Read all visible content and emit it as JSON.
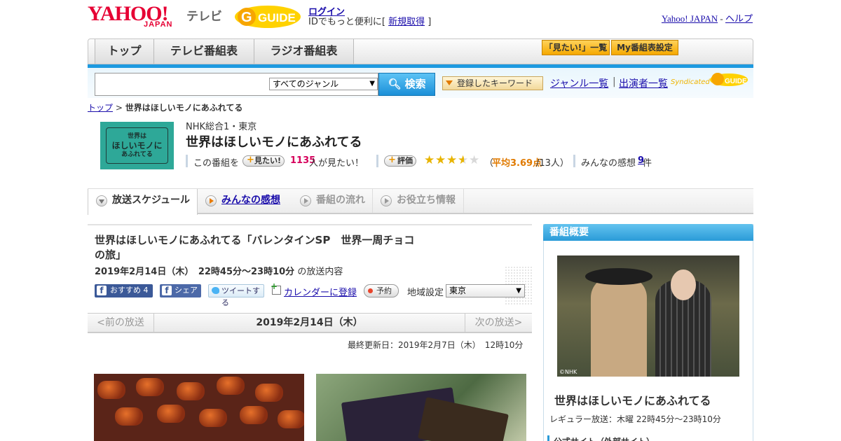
{
  "header": {
    "logo": "YAHOO!",
    "logo_sub": "JAPAN",
    "tv_label": "テレビ",
    "guide_logo": "GUIDE",
    "login": "ログイン",
    "login_prompt": "IDでもっと便利に[",
    "signup": "新規取得",
    "login_close": "]",
    "yahoo_japan": "Yahoo! JAPAN",
    "dash": "-",
    "help": "ヘルプ"
  },
  "nav": {
    "tabs": [
      "トップ",
      "テレビ番組表",
      "ラジオ番組表"
    ],
    "watchlist": "「見たい!」一覧",
    "my_settings": "My番組表設定"
  },
  "search": {
    "genre": "すべてのジャンル",
    "button": "検索",
    "keywords": "登録したキーワード",
    "genre_list": "ジャンル一覧",
    "sep": "|",
    "cast_list": "出演者一覧",
    "syndicated": "Syndicated"
  },
  "breadcrumb": {
    "home": "トップ",
    "sep": ">",
    "current": "世界はほしいモノにあふれてる"
  },
  "program": {
    "thumb_text_1": "世界は",
    "thumb_text_2": "ほしいモノに",
    "thumb_text_3": "あふれてる",
    "station": "NHK総合1・東京",
    "title": "世界はほしいモノにあふれてる",
    "this_program": "この番組を",
    "mitai": "見たい!",
    "mitai_count": "1135",
    "mitai_suffix": "人が見たい！",
    "rate_btn": "評価",
    "rating": 3.69,
    "avg_open": "（",
    "avg_label": "平均3.69点",
    "avg_count": "/13人）",
    "reviews_label": "みんなの感想",
    "reviews_count": "9",
    "reviews_suffix": "件"
  },
  "tabs": [
    {
      "label": "放送スケジュール"
    },
    {
      "label": "みんなの感想"
    },
    {
      "label": "番組の流れ"
    },
    {
      "label": "お役立ち情報"
    }
  ],
  "episode": {
    "title": "世界はほしいモノにあふれてる「バレンタインSP　世界一周チョコの旅」",
    "date_time": "2019年2月14日（木）　22時45分～23時10分",
    "date_suffix": "の放送内容",
    "fb_recommend": "おすすめ",
    "fb_recommend_count": "4",
    "fb_share": "シェア",
    "tweet": "ツイートする",
    "calendar": "カレンダーに登録",
    "reserve": "予約",
    "region_label": "地域設定",
    "region": "東京"
  },
  "pager": {
    "prev": "<前の放送",
    "current": "2019年2月14日（木）",
    "next": "次の放送>"
  },
  "updated": "最終更新日：2019年2月7日（木）　12時10分",
  "sidebar": {
    "heading": "番組概要",
    "photo_credit": "©NHK",
    "title": "世界はほしいモノにあふれてる",
    "regular": "レギュラー放送：木曜 22時45分～23時10分",
    "official": "公式サイト（外部サイト）"
  },
  "colors": {
    "accent_blue": "#1d9ae0",
    "brand_red": "#e60033",
    "star": "#e8b400",
    "link": "#1a0dab"
  }
}
